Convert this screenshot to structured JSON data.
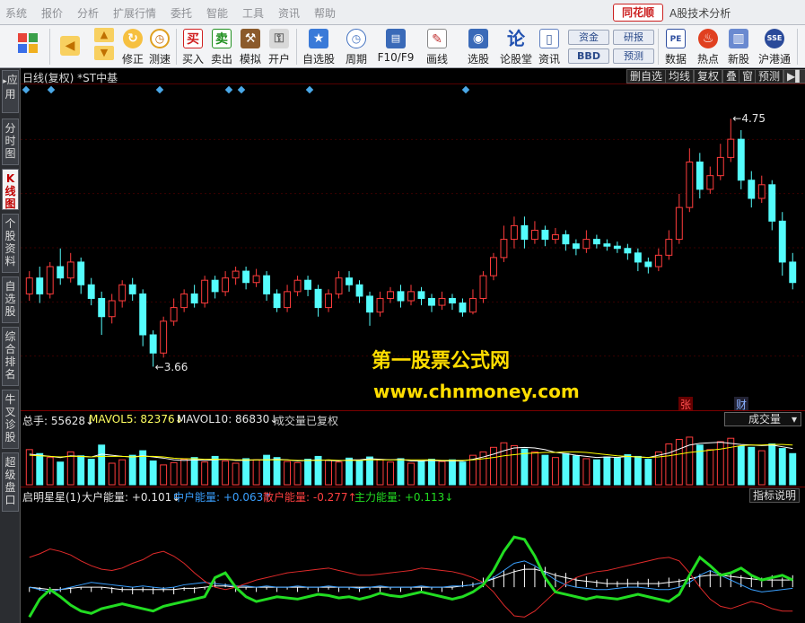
{
  "menu": [
    "系统",
    "报价",
    "分析",
    "扩展行情",
    "委托",
    "智能",
    "工具",
    "资讯",
    "帮助"
  ],
  "app": {
    "logo": "同花顺",
    "title": "A股技术分析"
  },
  "toolbar": {
    "buttons": [
      "修正",
      "测速",
      "买入",
      "卖出",
      "模拟",
      "开户",
      "自选股",
      "周期",
      "F10/F9",
      "画线",
      "选股",
      "论股堂",
      "资讯",
      "数据",
      "热点",
      "新股",
      "沪港通"
    ],
    "small_buttons": [
      "资金",
      "BBD",
      "研报",
      "预测"
    ]
  },
  "sidebar": {
    "tabs": [
      "应用",
      "分时图",
      "K线图",
      "个股资料",
      "自选股",
      "综合排名",
      "牛叉诊股",
      "超级盘口"
    ],
    "active": "K线图"
  },
  "chart_header": {
    "title": "日线(复权)  *ST中基",
    "buttons": [
      "删自选",
      "均线",
      "复权",
      "叠",
      "窗",
      "预测"
    ]
  },
  "price_labels": {
    "high": "4.75",
    "low": "3.66"
  },
  "markers": {
    "zhang": "张",
    "cai": "财"
  },
  "watermark": {
    "line1": "第一股票公式网",
    "line2": "www.chnmoney.com"
  },
  "volume_header": {
    "total": "总手: 55628↓",
    "ma5": "MAVOL5: 82376↓",
    "ma10": "MAVOL10: 86830↓",
    "note": "成交量已复权",
    "select": "成交量"
  },
  "indicator_header": {
    "name": "启明星星(1)",
    "big": "大户能量: +0.101↓",
    "mid": "中户能量: +0.063↑",
    "retail": "散户能量: -0.277↑",
    "main": "主力能量: +0.113↓",
    "btn": "指标说明"
  },
  "colors": {
    "up": "#ff3c3c",
    "down": "#54fcfc",
    "ma5": "#ffffff",
    "ma10": "#ffff00",
    "green": "#22dd22",
    "blue": "#3aa0ff",
    "label_white": "#e6e6e6"
  },
  "chart_data": {
    "type": "candlestick",
    "ylim": [
      3.5,
      4.85
    ],
    "high": 4.75,
    "low": 3.66,
    "candles": [
      [
        3.98,
        4.05,
        4.08,
        3.95
      ],
      [
        4.05,
        3.98,
        4.1,
        3.94
      ],
      [
        3.98,
        4.1,
        4.12,
        3.96
      ],
      [
        4.1,
        4.05,
        4.18,
        4.02
      ],
      [
        4.05,
        4.12,
        4.16,
        4.03
      ],
      [
        4.12,
        4.02,
        4.14,
        3.98
      ],
      [
        4.02,
        3.96,
        4.05,
        3.93
      ],
      [
        3.96,
        3.88,
        3.99,
        3.8
      ],
      [
        3.88,
        3.95,
        3.98,
        3.85
      ],
      [
        3.95,
        4.02,
        4.04,
        3.92
      ],
      [
        4.02,
        3.98,
        4.05,
        3.95
      ],
      [
        3.98,
        3.8,
        4.0,
        3.75
      ],
      [
        3.8,
        3.72,
        3.82,
        3.66
      ],
      [
        3.72,
        3.86,
        3.88,
        3.7
      ],
      [
        3.86,
        3.92,
        3.96,
        3.84
      ],
      [
        3.92,
        3.98,
        4.0,
        3.9
      ],
      [
        3.98,
        3.94,
        4.02,
        3.92
      ],
      [
        3.94,
        4.04,
        4.06,
        3.92
      ],
      [
        4.04,
        3.99,
        4.06,
        3.96
      ],
      [
        3.99,
        4.05,
        4.08,
        3.97
      ],
      [
        4.05,
        4.08,
        4.1,
        4.02
      ],
      [
        4.08,
        4.03,
        4.1,
        4.0
      ],
      [
        4.03,
        4.06,
        4.09,
        4.01
      ],
      [
        4.06,
        3.98,
        4.08,
        3.95
      ],
      [
        3.98,
        3.92,
        4.0,
        3.9
      ],
      [
        3.92,
        3.99,
        4.02,
        3.9
      ],
      [
        3.99,
        4.04,
        4.06,
        3.97
      ],
      [
        4.04,
        4.0,
        4.06,
        3.97
      ],
      [
        4.0,
        3.92,
        4.02,
        3.88
      ],
      [
        3.92,
        3.98,
        4.0,
        3.9
      ],
      [
        3.98,
        4.05,
        4.08,
        3.96
      ],
      [
        4.05,
        4.02,
        4.08,
        3.99
      ],
      [
        4.02,
        3.97,
        4.04,
        3.94
      ],
      [
        3.97,
        3.9,
        3.99,
        3.84
      ],
      [
        3.9,
        3.96,
        3.99,
        3.88
      ],
      [
        3.96,
        3.99,
        4.01,
        3.94
      ],
      [
        3.99,
        3.95,
        4.02,
        3.92
      ],
      [
        3.95,
        3.99,
        4.02,
        3.93
      ],
      [
        3.99,
        3.96,
        4.01,
        3.93
      ],
      [
        3.96,
        3.93,
        3.98,
        3.9
      ],
      [
        3.93,
        3.96,
        3.99,
        3.91
      ],
      [
        3.96,
        3.94,
        3.98,
        3.91
      ],
      [
        3.94,
        3.9,
        3.96,
        3.88
      ],
      [
        3.9,
        3.96,
        4.0,
        3.89
      ],
      [
        3.96,
        4.06,
        4.08,
        3.94
      ],
      [
        4.06,
        4.14,
        4.16,
        4.04
      ],
      [
        4.14,
        4.22,
        4.28,
        4.12
      ],
      [
        4.22,
        4.28,
        4.32,
        4.18
      ],
      [
        4.28,
        4.22,
        4.32,
        4.18
      ],
      [
        4.22,
        4.26,
        4.3,
        4.2
      ],
      [
        4.26,
        4.22,
        4.28,
        4.19
      ],
      [
        4.22,
        4.24,
        4.27,
        4.2
      ],
      [
        4.24,
        4.2,
        4.26,
        4.17
      ],
      [
        4.2,
        4.18,
        4.22,
        4.15
      ],
      [
        4.18,
        4.22,
        4.26,
        4.16
      ],
      [
        4.22,
        4.2,
        4.24,
        4.18
      ],
      [
        4.2,
        4.19,
        4.22,
        4.17
      ],
      [
        4.19,
        4.18,
        4.21,
        4.16
      ],
      [
        4.18,
        4.16,
        4.2,
        4.13
      ],
      [
        4.16,
        4.12,
        4.18,
        4.08
      ],
      [
        4.12,
        4.1,
        4.14,
        4.07
      ],
      [
        4.1,
        4.15,
        4.18,
        4.08
      ],
      [
        4.15,
        4.22,
        4.26,
        4.13
      ],
      [
        4.22,
        4.36,
        4.42,
        4.2
      ],
      [
        4.36,
        4.56,
        4.62,
        4.34
      ],
      [
        4.56,
        4.44,
        4.6,
        4.4
      ],
      [
        4.44,
        4.5,
        4.54,
        4.42
      ],
      [
        4.5,
        4.58,
        4.64,
        4.48
      ],
      [
        4.58,
        4.66,
        4.75,
        4.56
      ],
      [
        4.66,
        4.48,
        4.7,
        4.44
      ],
      [
        4.48,
        4.4,
        4.52,
        4.36
      ],
      [
        4.4,
        4.46,
        4.5,
        4.38
      ],
      [
        4.46,
        4.3,
        4.48,
        4.26
      ],
      [
        4.3,
        4.12,
        4.34,
        4.06
      ],
      [
        4.12,
        4.03,
        4.16,
        4.0
      ]
    ],
    "volume": [
      62,
      55,
      48,
      40,
      58,
      51,
      45,
      70,
      38,
      44,
      52,
      60,
      42,
      35,
      39,
      45,
      48,
      40,
      50,
      42,
      38,
      46,
      44,
      52,
      48,
      41,
      39,
      45,
      50,
      43,
      40,
      47,
      42,
      49,
      44,
      40,
      46,
      38,
      42,
      45,
      41,
      44,
      40,
      52,
      58,
      66,
      74,
      69,
      63,
      58,
      52,
      48,
      55,
      51,
      46,
      44,
      49,
      47,
      53,
      50,
      45,
      58,
      72,
      80,
      84,
      70,
      62,
      76,
      82,
      68,
      66,
      60,
      72,
      64,
      55
    ],
    "ma5": [
      54,
      52,
      50,
      48,
      51,
      50,
      49,
      54,
      52,
      50,
      49,
      51,
      49,
      47,
      44,
      43,
      44,
      43,
      44,
      45,
      43,
      43,
      44,
      44,
      45,
      44,
      42,
      43,
      44,
      43,
      42,
      44,
      44,
      46,
      45,
      44,
      45,
      42,
      42,
      43,
      42,
      42,
      42,
      45,
      49,
      54,
      60,
      65,
      66,
      65,
      62,
      57,
      55,
      52,
      50,
      48,
      49,
      48,
      50,
      49,
      48,
      52,
      56,
      63,
      70,
      73,
      74,
      75,
      73,
      71,
      70,
      69,
      70,
      67,
      64
    ],
    "ma10": [
      52,
      51,
      50,
      49,
      50,
      50,
      49,
      50,
      50,
      50,
      49,
      50,
      50,
      49,
      47,
      46,
      46,
      45,
      45,
      45,
      44,
      44,
      44,
      44,
      44,
      44,
      43,
      43,
      43,
      44,
      43,
      43,
      43,
      44,
      44,
      44,
      44,
      44,
      44,
      44,
      43,
      43,
      43,
      44,
      46,
      48,
      51,
      53,
      55,
      56,
      57,
      57,
      58,
      58,
      57,
      55,
      53,
      51,
      50,
      49,
      48,
      49,
      51,
      54,
      57,
      59,
      61,
      63,
      66,
      69,
      70,
      70,
      71,
      71,
      70
    ],
    "indicator": {
      "red": [
        0.55,
        0.58,
        0.62,
        0.6,
        0.57,
        0.52,
        0.48,
        0.45,
        0.44,
        0.46,
        0.5,
        0.53,
        0.58,
        0.6,
        0.56,
        0.5,
        0.42,
        0.35,
        0.3,
        0.28,
        0.3,
        0.33,
        0.36,
        0.38,
        0.4,
        0.42,
        0.43,
        0.44,
        0.45,
        0.46,
        0.44,
        0.42,
        0.4,
        0.4,
        0.41,
        0.42,
        0.43,
        0.44,
        0.46,
        0.45,
        0.44,
        0.43,
        0.41,
        0.38,
        0.34,
        0.26,
        0.15,
        0.06,
        0.05,
        0.1,
        0.18,
        0.26,
        0.33,
        0.38,
        0.41,
        0.43,
        0.44,
        0.46,
        0.48,
        0.5,
        0.52,
        0.54,
        0.55,
        0.52,
        0.42,
        0.3,
        0.2,
        0.14,
        0.12,
        0.15,
        0.18,
        0.16,
        0.12,
        0.1,
        0.1
      ],
      "green": [
        0.05,
        0.2,
        0.28,
        0.22,
        0.15,
        0.1,
        0.08,
        0.12,
        0.14,
        0.16,
        0.14,
        0.12,
        0.1,
        0.14,
        0.16,
        0.18,
        0.2,
        0.22,
        0.38,
        0.42,
        0.3,
        0.22,
        0.18,
        0.2,
        0.22,
        0.21,
        0.2,
        0.22,
        0.24,
        0.23,
        0.21,
        0.22,
        0.2,
        0.22,
        0.25,
        0.23,
        0.22,
        0.24,
        0.26,
        0.24,
        0.22,
        0.2,
        0.22,
        0.26,
        0.32,
        0.44,
        0.6,
        0.72,
        0.7,
        0.56,
        0.38,
        0.26,
        0.24,
        0.22,
        0.2,
        0.22,
        0.21,
        0.2,
        0.22,
        0.24,
        0.22,
        0.2,
        0.18,
        0.24,
        0.4,
        0.55,
        0.48,
        0.4,
        0.42,
        0.46,
        0.4,
        0.36,
        0.38,
        0.4,
        0.36
      ],
      "blue": [
        0.3,
        0.28,
        0.26,
        0.28,
        0.3,
        0.32,
        0.34,
        0.33,
        0.32,
        0.31,
        0.3,
        0.31,
        0.3,
        0.29,
        0.3,
        0.32,
        0.33,
        0.34,
        0.33,
        0.32,
        0.31,
        0.31,
        0.3,
        0.31,
        0.3,
        0.3,
        0.31,
        0.3,
        0.3,
        0.31,
        0.3,
        0.3,
        0.29,
        0.3,
        0.31,
        0.3,
        0.3,
        0.3,
        0.31,
        0.3,
        0.3,
        0.31,
        0.31,
        0.32,
        0.34,
        0.38,
        0.44,
        0.5,
        0.52,
        0.48,
        0.42,
        0.36,
        0.32,
        0.3,
        0.29,
        0.28,
        0.28,
        0.29,
        0.3,
        0.3,
        0.29,
        0.28,
        0.28,
        0.3,
        0.34,
        0.4,
        0.44,
        0.4,
        0.36,
        0.32,
        0.28,
        0.26,
        0.27,
        0.28,
        0.29
      ],
      "white": [
        0.3,
        0.29,
        0.28,
        0.28,
        0.29,
        0.3,
        0.3,
        0.3,
        0.29,
        0.28,
        0.28,
        0.28,
        0.28,
        0.28,
        0.28,
        0.29,
        0.29,
        0.3,
        0.31,
        0.31,
        0.3,
        0.3,
        0.3,
        0.3,
        0.3,
        0.3,
        0.3,
        0.3,
        0.3,
        0.3,
        0.3,
        0.3,
        0.3,
        0.3,
        0.3,
        0.3,
        0.3,
        0.3,
        0.3,
        0.3,
        0.3,
        0.3,
        0.31,
        0.32,
        0.34,
        0.37,
        0.4,
        0.43,
        0.45,
        0.45,
        0.43,
        0.4,
        0.38,
        0.36,
        0.35,
        0.34,
        0.33,
        0.33,
        0.33,
        0.33,
        0.33,
        0.33,
        0.34,
        0.35,
        0.37,
        0.39,
        0.4,
        0.4,
        0.39,
        0.38,
        0.37,
        0.36,
        0.36,
        0.36,
        0.36
      ]
    }
  }
}
